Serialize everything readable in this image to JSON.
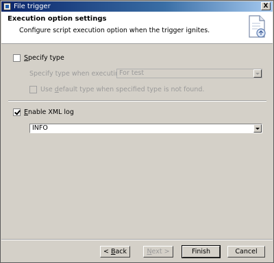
{
  "window": {
    "title": "File trigger",
    "close_label": "X"
  },
  "banner": {
    "heading": "Execution option settings",
    "description": "Configure script execution option when the trigger ignites."
  },
  "specify_type": {
    "label_mnemonic": "S",
    "label_rest": "pecify type",
    "checked": false,
    "when_executing_label": "Specify type when executing:",
    "selected_value": "For test",
    "use_default_pre": "Use ",
    "use_default_mnemonic": "d",
    "use_default_post": "efault type when specified type is not found."
  },
  "xml_log": {
    "label_mnemonic": "E",
    "label_rest": "nable XML log",
    "checked": true,
    "selected_value": "INFO"
  },
  "buttons": {
    "back_prefix": "< ",
    "back_mnemonic": "B",
    "back_rest": "ack",
    "next_prefix": "",
    "next_mnemonic": "N",
    "next_rest": "ext >",
    "finish": "Finish",
    "cancel": "Cancel"
  }
}
